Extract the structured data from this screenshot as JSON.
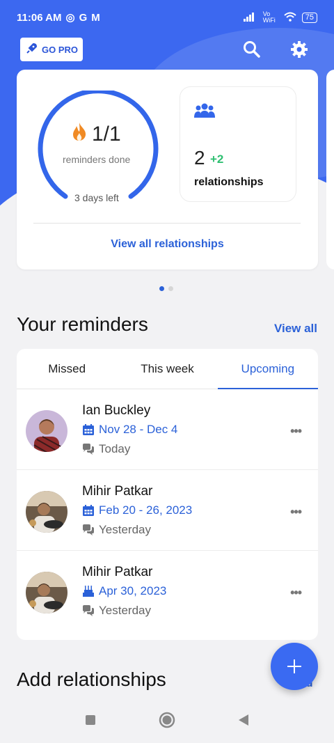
{
  "status_bar": {
    "time": "11:06 AM",
    "network": "Vo WiFi",
    "battery": "75"
  },
  "top_bar": {
    "go_pro_label": "GO PRO"
  },
  "summary": {
    "reminders_done": "1/1",
    "reminders_label": "reminders done",
    "days_left": "3 days left",
    "reminders_progress": 1.0,
    "relationships_count": "2",
    "relationships_delta": "+2",
    "relationships_label": "relationships",
    "view_all_label": "View all relationships"
  },
  "pager": {
    "count": 2,
    "active": 0
  },
  "reminders": {
    "title": "Your reminders",
    "view_all": "View all",
    "tabs": [
      {
        "label": "Missed"
      },
      {
        "label": "This week"
      },
      {
        "label": "Upcoming"
      }
    ],
    "active_tab": 2,
    "items": [
      {
        "name": "Ian Buckley",
        "date": "Nov 28 - Dec 4",
        "date_icon": "calendar-icon",
        "last": "Today"
      },
      {
        "name": "Mihir Patkar",
        "date": "Feb 20 - 26, 2023",
        "date_icon": "calendar-icon",
        "last": "Yesterday"
      },
      {
        "name": "Mihir Patkar",
        "date": "Apr 30, 2023",
        "date_icon": "birthday-cake-icon",
        "last": "Yesterday"
      }
    ]
  },
  "add_section": {
    "title": "Add relationships",
    "link": "nd"
  },
  "colors": {
    "accent": "#3c68f0",
    "link": "#2b61d8",
    "green": "#2fbf71"
  }
}
